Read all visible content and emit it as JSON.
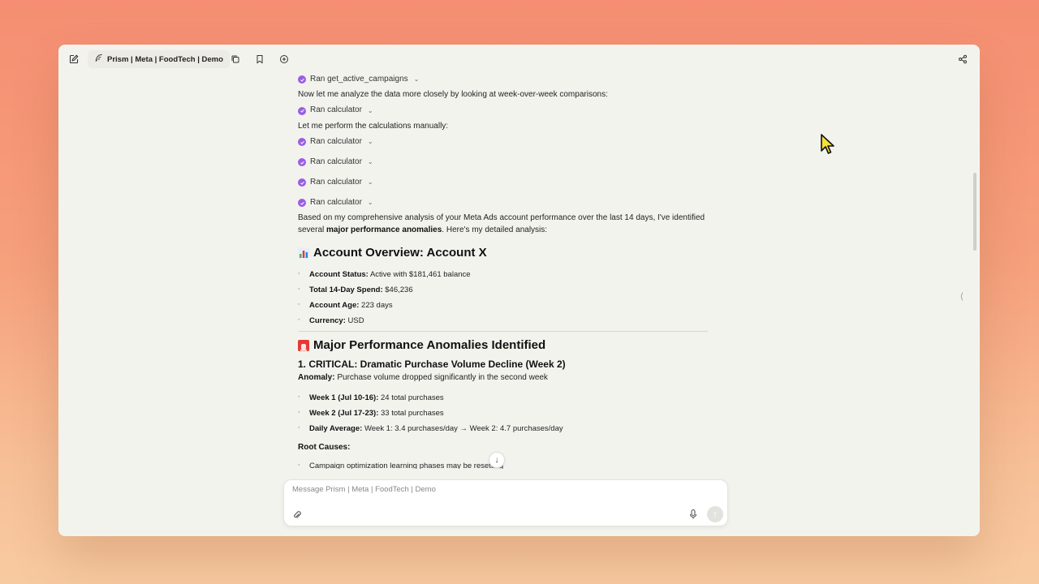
{
  "toolbar": {
    "title": "Prism | Meta | FoodTech | Demo",
    "icons": [
      "new-chat-icon",
      "feather-icon",
      "copy-icon",
      "bookmark-icon",
      "plus-circle-icon",
      "share-icon"
    ]
  },
  "messages": {
    "tool_1": "Ran get_active_campaigns",
    "para_1": "Now let me analyze the data more closely by looking at week-over-week comparisons:",
    "tool_2": "Ran calculator",
    "para_2": "Let me perform the calculations manually:",
    "tool_3": "Ran calculator",
    "tool_4": "Ran calculator",
    "tool_5": "Ran calculator",
    "tool_6": "Ran calculator",
    "para_3a": "Based on my comprehensive analysis of your Meta Ads account performance over the last 14 days, I've identified several ",
    "para_3b": "major performance anomalies",
    "para_3c": ". Here's my detailed analysis:"
  },
  "overview": {
    "heading": "Account Overview: Account X",
    "items": [
      {
        "label": "Account Status:",
        "value": " Active with $181,461 balance"
      },
      {
        "label": "Total 14-Day Spend:",
        "value": " $46,236"
      },
      {
        "label": "Account Age:",
        "value": " 223 days"
      },
      {
        "label": "Currency:",
        "value": " USD"
      }
    ]
  },
  "anomalies": {
    "heading": "Major Performance Anomalies Identified",
    "sub_heading": "1. CRITICAL: Dramatic Purchase Volume Decline (Week 2)",
    "anomaly_label": "Anomaly:",
    "anomaly_text": " Purchase volume dropped significantly in the second week",
    "items": [
      {
        "label": "Week 1 (Jul 10-16):",
        "value": " 24 total purchases"
      },
      {
        "label": "Week 2 (Jul 17-23):",
        "value": " 33 total purchases"
      },
      {
        "label": "Daily Average:",
        "value": " Week 1: 3.4 purchases/day → Week 2: 4.7 purchases/day"
      }
    ],
    "root_causes_label": "Root Causes:",
    "root_cause_1": "Campaign optimization learning phases may be resetting"
  },
  "composer": {
    "placeholder": "Message Prism | Meta | FoodTech | Demo"
  },
  "colors": {
    "accent": "#9b5de5",
    "background_top": "#f58e72",
    "window": "#f3f3ee"
  }
}
